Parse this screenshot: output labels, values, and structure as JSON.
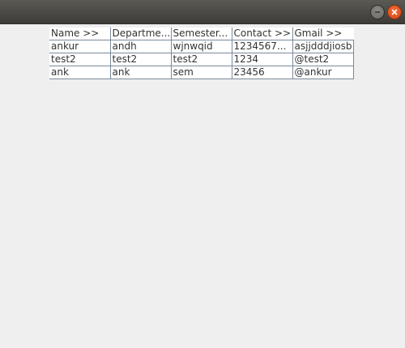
{
  "window": {
    "buttons": [
      {
        "name": "minimize",
        "icon": "minimize-icon"
      },
      {
        "name": "close",
        "icon": "close-icon"
      }
    ]
  },
  "table": {
    "columns": [
      "Name >>",
      "Departme...",
      "Semester...",
      "Contact >>",
      "Gmail >>"
    ],
    "rows": [
      [
        "ankur",
        "andh",
        "wjnwqid",
        "1234567...",
        "asjjdddjiosb"
      ],
      [
        "test2",
        "test2",
        "test2",
        "1234",
        "@test2"
      ],
      [
        "ank",
        "ank",
        "sem",
        "23456",
        "@ankur"
      ]
    ]
  }
}
